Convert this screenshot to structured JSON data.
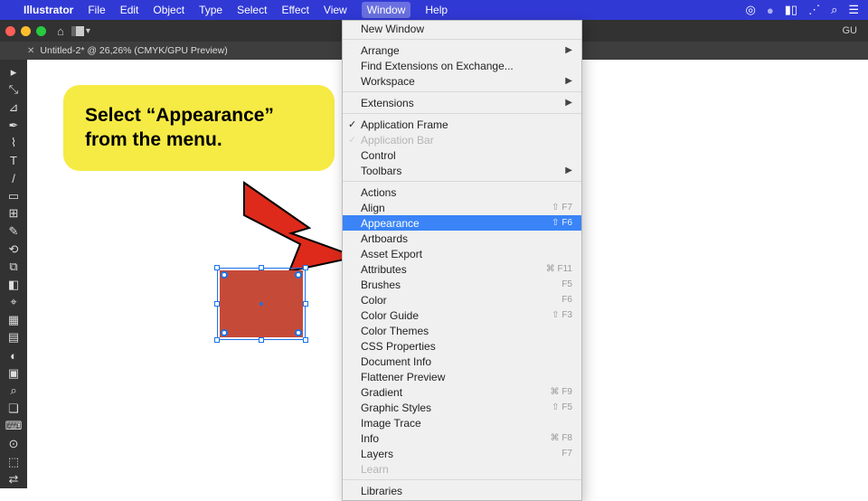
{
  "menubar": {
    "app": "Illustrator",
    "items": [
      "File",
      "Edit",
      "Object",
      "Type",
      "Select",
      "Effect",
      "View",
      "Window",
      "Help"
    ],
    "open_index": 7
  },
  "status_icons": {
    "cc": "◎",
    "user": "⦿",
    "battery": "⚡︎",
    "wifi": "⋮⋮",
    "search": "⌕",
    "control": "≡"
  },
  "appbar": {
    "gu": "GU"
  },
  "tab": {
    "title": "Untitled-2* @ 26,26% (CMYK/GPU Preview)"
  },
  "callout": {
    "text": "Select “Appearance” from the menu."
  },
  "menu": {
    "groups": [
      [
        {
          "label": "New Window",
          "type": "item"
        }
      ],
      [
        {
          "label": "Arrange",
          "type": "sub"
        },
        {
          "label": "Find Extensions on Exchange...",
          "type": "item"
        },
        {
          "label": "Workspace",
          "type": "sub"
        }
      ],
      [
        {
          "label": "Extensions",
          "type": "sub"
        }
      ],
      [
        {
          "label": "Application Frame",
          "type": "check"
        },
        {
          "label": "Application Bar",
          "type": "disabled-check"
        },
        {
          "label": "Control",
          "type": "item"
        },
        {
          "label": "Toolbars",
          "type": "sub"
        }
      ],
      [
        {
          "label": "Actions",
          "type": "item"
        },
        {
          "label": "Align",
          "type": "item",
          "kb": "⇧ F7"
        },
        {
          "label": "Appearance",
          "type": "item",
          "kb": "⇧ F6",
          "selected": true
        },
        {
          "label": "Artboards",
          "type": "item"
        },
        {
          "label": "Asset Export",
          "type": "item"
        },
        {
          "label": "Attributes",
          "type": "item",
          "kb": "⌘ F11"
        },
        {
          "label": "Brushes",
          "type": "item",
          "kb": "F5"
        },
        {
          "label": "Color",
          "type": "item",
          "kb": "F6"
        },
        {
          "label": "Color Guide",
          "type": "item",
          "kb": "⇧ F3"
        },
        {
          "label": "Color Themes",
          "type": "item"
        },
        {
          "label": "CSS Properties",
          "type": "item"
        },
        {
          "label": "Document Info",
          "type": "item"
        },
        {
          "label": "Flattener Preview",
          "type": "item"
        },
        {
          "label": "Gradient",
          "type": "item",
          "kb": "⌘ F9"
        },
        {
          "label": "Graphic Styles",
          "type": "item",
          "kb": "⇧ F5"
        },
        {
          "label": "Image Trace",
          "type": "item"
        },
        {
          "label": "Info",
          "type": "item",
          "kb": "⌘ F8"
        },
        {
          "label": "Layers",
          "type": "item",
          "kb": "F7"
        },
        {
          "label": "Learn",
          "type": "disabled"
        }
      ],
      [
        {
          "label": "Libraries",
          "type": "item"
        }
      ]
    ]
  },
  "tools": [
    "▸",
    "⤡",
    "⊿",
    "✒",
    "⌇",
    "T",
    "/",
    "▭",
    "⊞",
    "✎",
    "⟲",
    "⧉",
    "◧",
    "⌖",
    "▦",
    "▤",
    "◐",
    "▣",
    "⌕",
    "❏",
    "⌨",
    "⊙",
    "⬚",
    "⇄"
  ]
}
